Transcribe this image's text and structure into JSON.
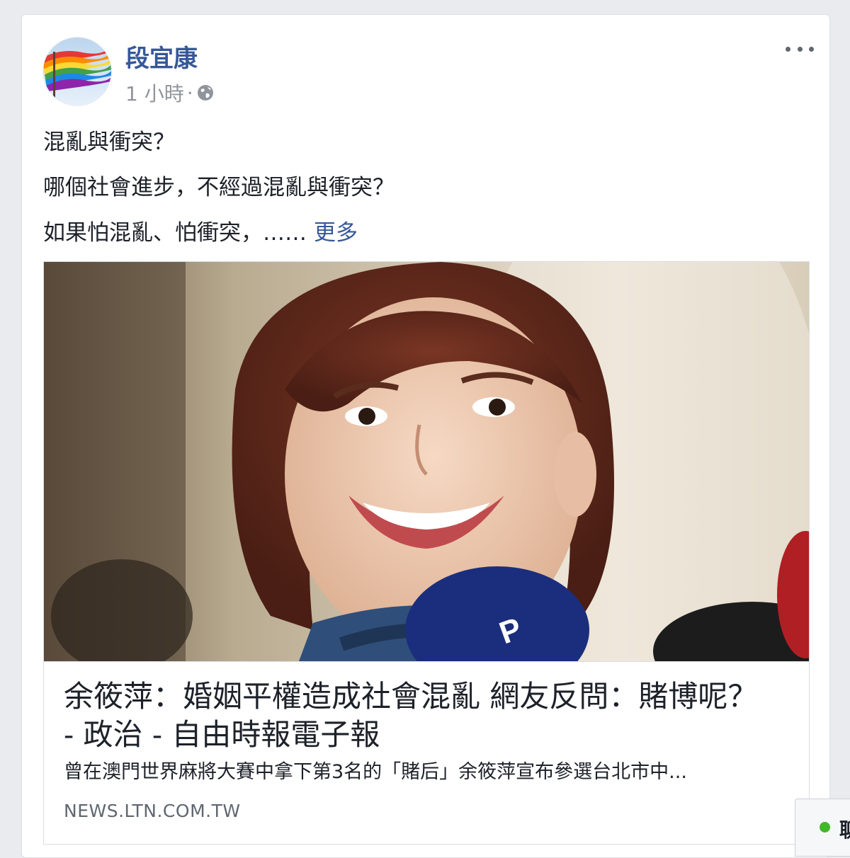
{
  "post": {
    "author": "段宜康",
    "timestamp": "1 小時",
    "separator": "·",
    "privacy_icon": "globe-icon",
    "options_icon": "more-options-icon",
    "lines": [
      "混亂與衝突？",
      "哪個社會進步，不經過混亂與衝突？",
      "如果怕混亂、怕衝突，……"
    ],
    "see_more": "更多"
  },
  "link_preview": {
    "title": "余筱萍：婚姻平權造成社會混亂 網友反問：賭博呢？ - 政治 - 自由時報電子報",
    "description": "曾在澳門世界麻將大賽中拿下第3名的「賭后」余筱萍宣布參選台北市中...",
    "domain": "NEWS.LTN.COM.TW"
  },
  "chat": {
    "label": "聊",
    "status_color": "#42b72a"
  },
  "colors": {
    "author_link": "#365899",
    "meta_text": "#90949c",
    "background": "#e9ebee"
  }
}
